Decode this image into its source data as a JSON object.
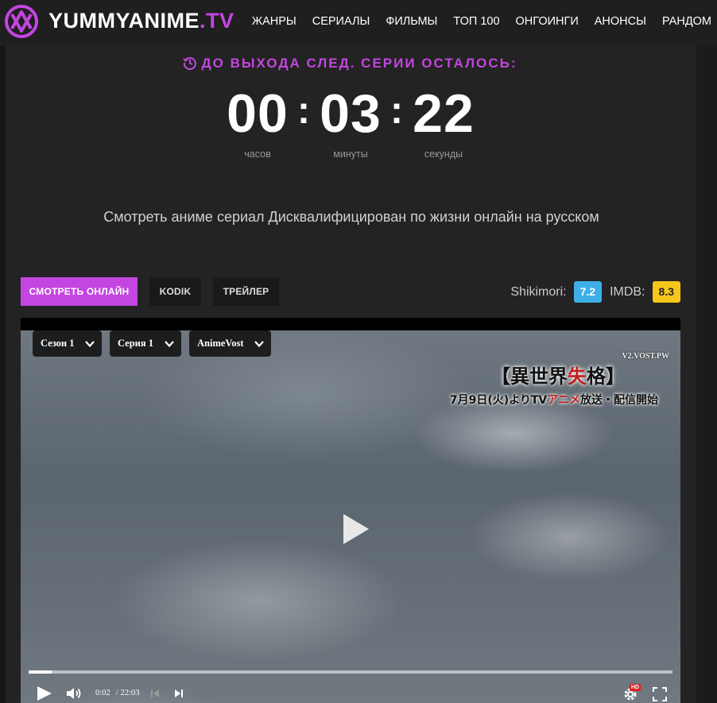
{
  "header": {
    "brand_main": "YUMMYANIME",
    "brand_tld": ".TV",
    "nav": [
      "ЖАНРЫ",
      "СЕРИАЛЫ",
      "ФИЛЬМЫ",
      "ТОП 100",
      "ОНГОИНГИ",
      "АНОНСЫ",
      "РАНДОМ"
    ]
  },
  "countdown": {
    "title": "ДО ВЫХОДА СЛЕД. СЕРИИ ОСТАЛОСЬ:",
    "hours": "00",
    "minutes": "03",
    "seconds": "22",
    "separator": ":",
    "hours_label": "часов",
    "minutes_label": "минуты",
    "seconds_label": "секунды"
  },
  "subtitle": "Смотреть аниме сериал Дисквалифицирован по жизни онлайн на русском",
  "tabs": {
    "watch": "СМОТРЕТЬ ОНЛАЙН",
    "kodik": "KODIK",
    "trailer": "ТРЕЙЛЕР"
  },
  "ratings": {
    "shikimori_label": "Shikimori:",
    "shikimori_value": "7.2",
    "imdb_label": "IMDB:",
    "imdb_value": "8.3"
  },
  "player": {
    "season_select": "Сезон 1",
    "episode_select": "Серия 1",
    "voice_select": "AnimeVost",
    "watermark": "V2.VOST.PW",
    "jp_title_a": "【異世界",
    "jp_title_red": "失",
    "jp_title_b": "格】",
    "jp_line_a": "7月9日(火)よりTV",
    "jp_line_red": "アニメ",
    "jp_line_b": "放送・配信開始",
    "current_time": "0:02",
    "duration": "/ 22:03",
    "hd_badge": "HD",
    "progress_fraction": 0.036
  },
  "colors": {
    "accent": "#c346e0",
    "shikimori": "#3cb0e6",
    "imdb": "#f6c61a"
  }
}
